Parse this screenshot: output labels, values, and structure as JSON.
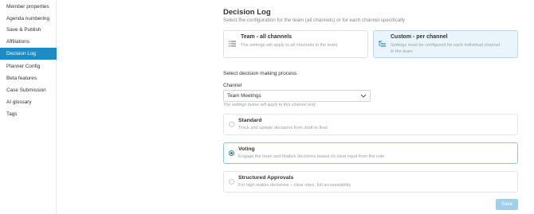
{
  "sidebar": {
    "items": [
      {
        "label": "Member properties"
      },
      {
        "label": "Agenda numbering"
      },
      {
        "label": "Save & Publish"
      },
      {
        "label": "Affiliations"
      },
      {
        "label": "Decision Log",
        "active": true
      },
      {
        "label": "Planner Config"
      },
      {
        "label": "Beta features"
      },
      {
        "label": "Case Submission"
      },
      {
        "label": "AI glossary"
      },
      {
        "label": "Tags"
      }
    ]
  },
  "main": {
    "title": "Decision Log",
    "subtitle": "Select the configuration for the team (all channels) or for each channel specifically",
    "scope_options": [
      {
        "title": "Team - all channels",
        "description": "The settings will apply to all channels in the team",
        "icon": "list-icon",
        "selected": false
      },
      {
        "title": "Custom - per channel",
        "description_line1": "Settings must be configured for each individual channel",
        "description_line2": "in the team",
        "icon": "channel-list-icon",
        "selected": true
      }
    ],
    "section_label": "Select decision making process",
    "channel": {
      "label": "Channel",
      "selected_value": "Team Meetings",
      "hint": "The settings below will apply to this channel only"
    },
    "process_options": [
      {
        "title": "Standard",
        "description": "Track and update decisions from draft to final",
        "selected": false
      },
      {
        "title": "Voting",
        "description": "Engage the team and finalize decisions based on clear input from the vote",
        "selected": true
      },
      {
        "title": "Structured Approvals",
        "description": "For high-stakes decisions – clear roles, full accountability",
        "selected": false
      }
    ],
    "save_label": "Save"
  },
  "colors": {
    "accent": "#1e8bc3",
    "selected_card_bg": "#eaf4fb",
    "save_button_disabled": "#9fd0ea"
  }
}
